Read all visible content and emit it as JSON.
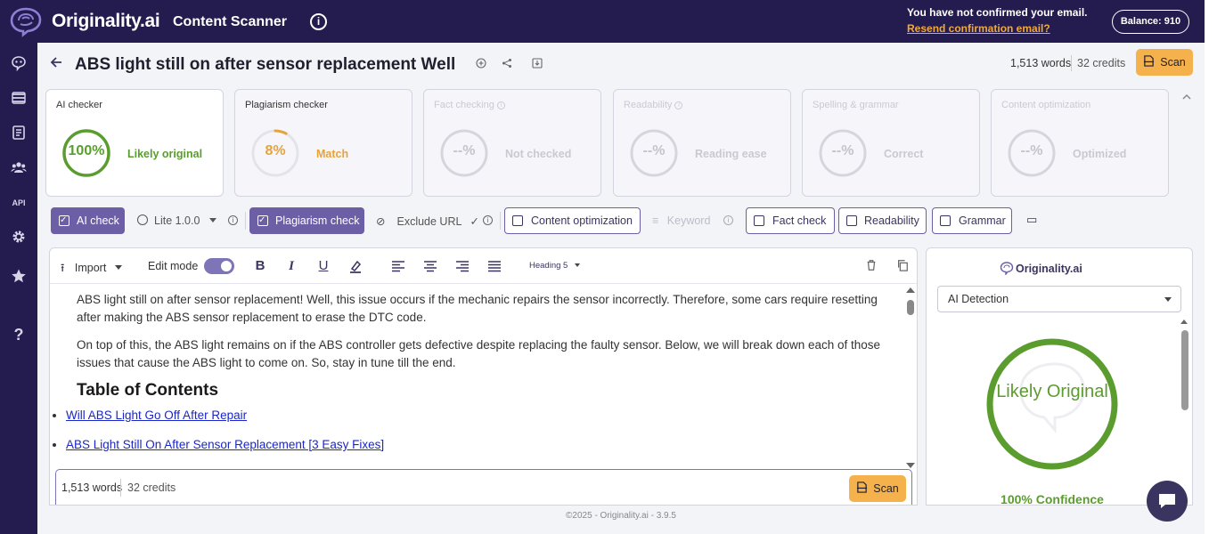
{
  "topbar": {
    "brand": "Originality.ai",
    "app_name": "Content Scanner",
    "email_notice": "You have not confirmed your email.",
    "email_link": "Resend confirmation email?",
    "balance": "Balance: 910"
  },
  "sidebar": {
    "items": [
      {
        "icon": "brain-icon"
      },
      {
        "icon": "layers-icon"
      },
      {
        "icon": "library-icon"
      },
      {
        "icon": "team-icon"
      },
      {
        "icon": "api-icon",
        "label": "API"
      },
      {
        "icon": "gear-icon"
      },
      {
        "icon": "star-icon"
      },
      {
        "icon": "help-icon",
        "label": "?"
      }
    ]
  },
  "header": {
    "title": "ABS light still on after sensor replacement Well",
    "words": "1,513 words",
    "credits": "32 credits",
    "scan_label": "Scan"
  },
  "checkers": [
    {
      "title": "AI checker",
      "value": "100%",
      "status": "Likely original",
      "progress": 1.0,
      "color": "#5a9d2e",
      "active": true
    },
    {
      "title": "Plagiarism checker",
      "value": "8%",
      "status": "Match",
      "progress": 0.08,
      "color": "#e8a23a",
      "active": false
    },
    {
      "title": "Fact checking",
      "value": "--%",
      "status": "Not checked",
      "dim": true
    },
    {
      "title": "Readability",
      "value": "--%",
      "status": "Reading ease",
      "dim": true
    },
    {
      "title": "Spelling & grammar",
      "value": "--%",
      "status": "Correct",
      "dim": true
    },
    {
      "title": "Content optimization",
      "value": "--%",
      "status": "Optimized",
      "dim": true
    }
  ],
  "toolbar": {
    "ai_check": "AI check",
    "model": "Lite 1.0.0",
    "plagiarism_check": "Plagiarism check",
    "exclude_url": "Exclude URL",
    "content_optimization": "Content optimization",
    "keyword": "Keyword",
    "fact_check": "Fact check",
    "readability": "Readability",
    "grammar": "Grammar"
  },
  "editor": {
    "import_label": "Import",
    "edit_mode_label": "Edit mode",
    "heading_select": "Heading 5",
    "paragraph_1": "ABS light still on after sensor replacement! Well, this issue occurs if the mechanic repairs the sensor incorrectly. Therefore, some cars require resetting after making the ABS sensor replacement to erase the DTC code.",
    "paragraph_2": "On top of this, the ABS light remains on if the ABS controller gets defective despite replacing the faulty sensor. Below, we will break down each of those issues that cause the ABS light to come on. So, stay in tune till the end.",
    "toc_heading": "Table of Contents",
    "toc_items": [
      "Will ABS Light Go Off After Repair",
      "ABS Light Still On After Sensor Replacement [3 Easy Fixes]"
    ],
    "footer_words": "1,513 words",
    "footer_credits": "32 credits",
    "footer_scan": "Scan"
  },
  "results_panel": {
    "brand": "Originality.ai",
    "mode_select": "AI Detection",
    "result_label": "Likely Original",
    "confidence": "100% Confidence",
    "ring_color": "#5a9d2e"
  },
  "footer": {
    "text": "©2025 - Originality.ai - 3.9.5"
  }
}
